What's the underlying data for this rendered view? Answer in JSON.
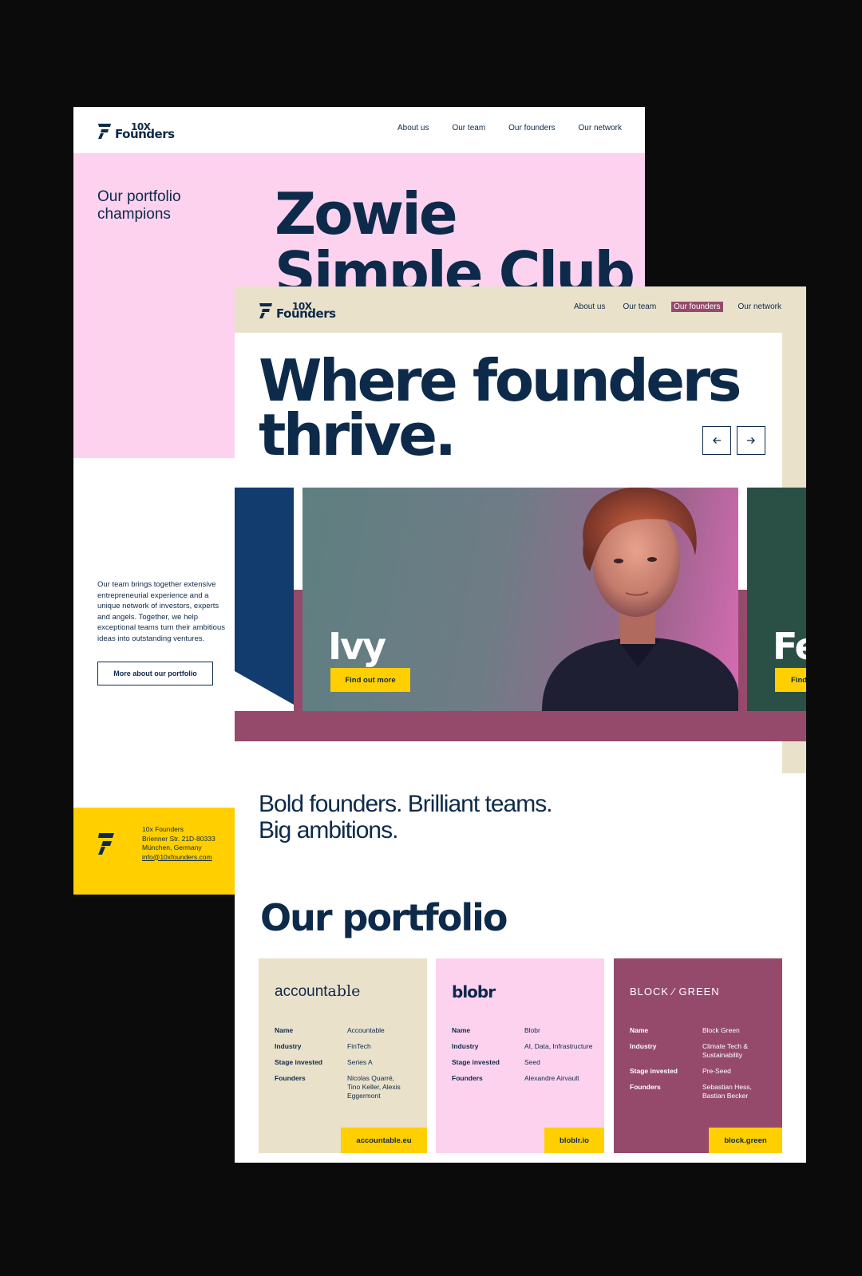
{
  "colors": {
    "navy": "#0d2a4a",
    "pink": "#fcd2ef",
    "beige": "#e9e1ca",
    "plum": "#954a6c",
    "yellow": "#ffcf00",
    "blue": "#113c6d",
    "green": "#2a4f45",
    "background": "#0b0b0b"
  },
  "logo": {
    "line1": "10X",
    "line2": "Founders",
    "icon": "10x-founders-logo-icon"
  },
  "nav": {
    "about": "About us",
    "team": "Our team",
    "founders": "Our founders",
    "network": "Our network"
  },
  "back_page": {
    "tagline": "Our portfolio champions",
    "champions": [
      "Zowie",
      "Simple Club"
    ],
    "paragraph": "Our team brings together extensive entrepreneurial experience and a unique network of investors, experts and angels. Together, we help exceptional teams turn their ambitious ideas into outstanding ventures.",
    "button": "More about our portfolio",
    "footer": {
      "company": "10x Founders",
      "street": "Brienner Str. 21D-80333",
      "city": "München, Germany",
      "email": "info@10xfounders.com"
    }
  },
  "front_page": {
    "active_nav": "Our founders",
    "headline_line1": "Where founders",
    "headline_line2": "thrive.",
    "carousel": {
      "prev_icon": "arrow-left-icon",
      "next_icon": "arrow-right-icon",
      "cards": [
        {
          "name": "Ivy",
          "button": "Find out more"
        },
        {
          "name": "Fe",
          "button": "Find"
        }
      ]
    },
    "subheading_line1": "Bold founders. Brilliant teams.",
    "subheading_line2": "Big ambitions.",
    "portfolio_title": "Our portfolio",
    "portfolio": [
      {
        "brand_a": "account",
        "brand_b": "able",
        "labels": [
          "Name",
          "Industry",
          "Stage invested",
          "Founders"
        ],
        "name": "Accountable",
        "industry": "FinTech",
        "stage": "Series A",
        "founders": "Nicolas Quarré, Tino Keller, Alexis Eggermont",
        "link": "accountable.eu"
      },
      {
        "brand_a": "blobr",
        "brand_b": "",
        "labels": [
          "Name",
          "Industry",
          "Stage invested",
          "Founders"
        ],
        "name": "Blobr",
        "industry": "AI, Data, Infrastructure",
        "stage": "Seed",
        "founders": "Alexandre Airvault",
        "link": "bloblr.io"
      },
      {
        "brand_a": "BLOCK ⁄ GREEN",
        "brand_b": "",
        "labels": [
          "Name",
          "Industry",
          "Stage invested",
          "Founders"
        ],
        "name": "Block Green",
        "industry": "Climate Tech & Sustainability",
        "stage": "Pre-Seed",
        "founders": "Sebastian Hess, Bastian Becker",
        "link": "block.green"
      }
    ]
  }
}
